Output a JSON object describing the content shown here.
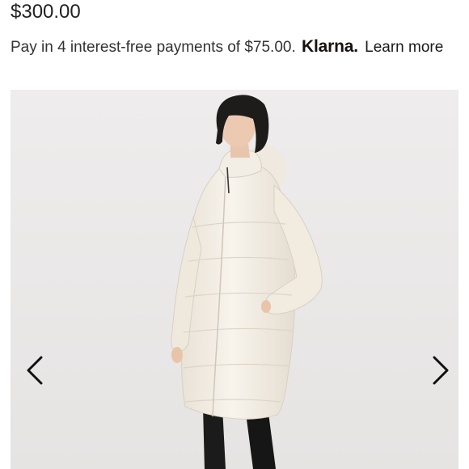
{
  "product": {
    "price": "$300.00",
    "installment_text": "Pay in 4 interest-free payments of $75.00.",
    "klarna_brand": "Klarna.",
    "learn_more_label": "Learn more"
  },
  "gallery": {
    "image_alt": "Woman wearing a long white hooded puffer parka",
    "prev_icon": "chevron-left-icon",
    "next_icon": "chevron-right-icon"
  },
  "colors": {
    "gallery_bg": "#eceaea",
    "jacket": "#f4efe6",
    "hair": "#1e1b1b",
    "leggings": "#1a1a1a"
  }
}
